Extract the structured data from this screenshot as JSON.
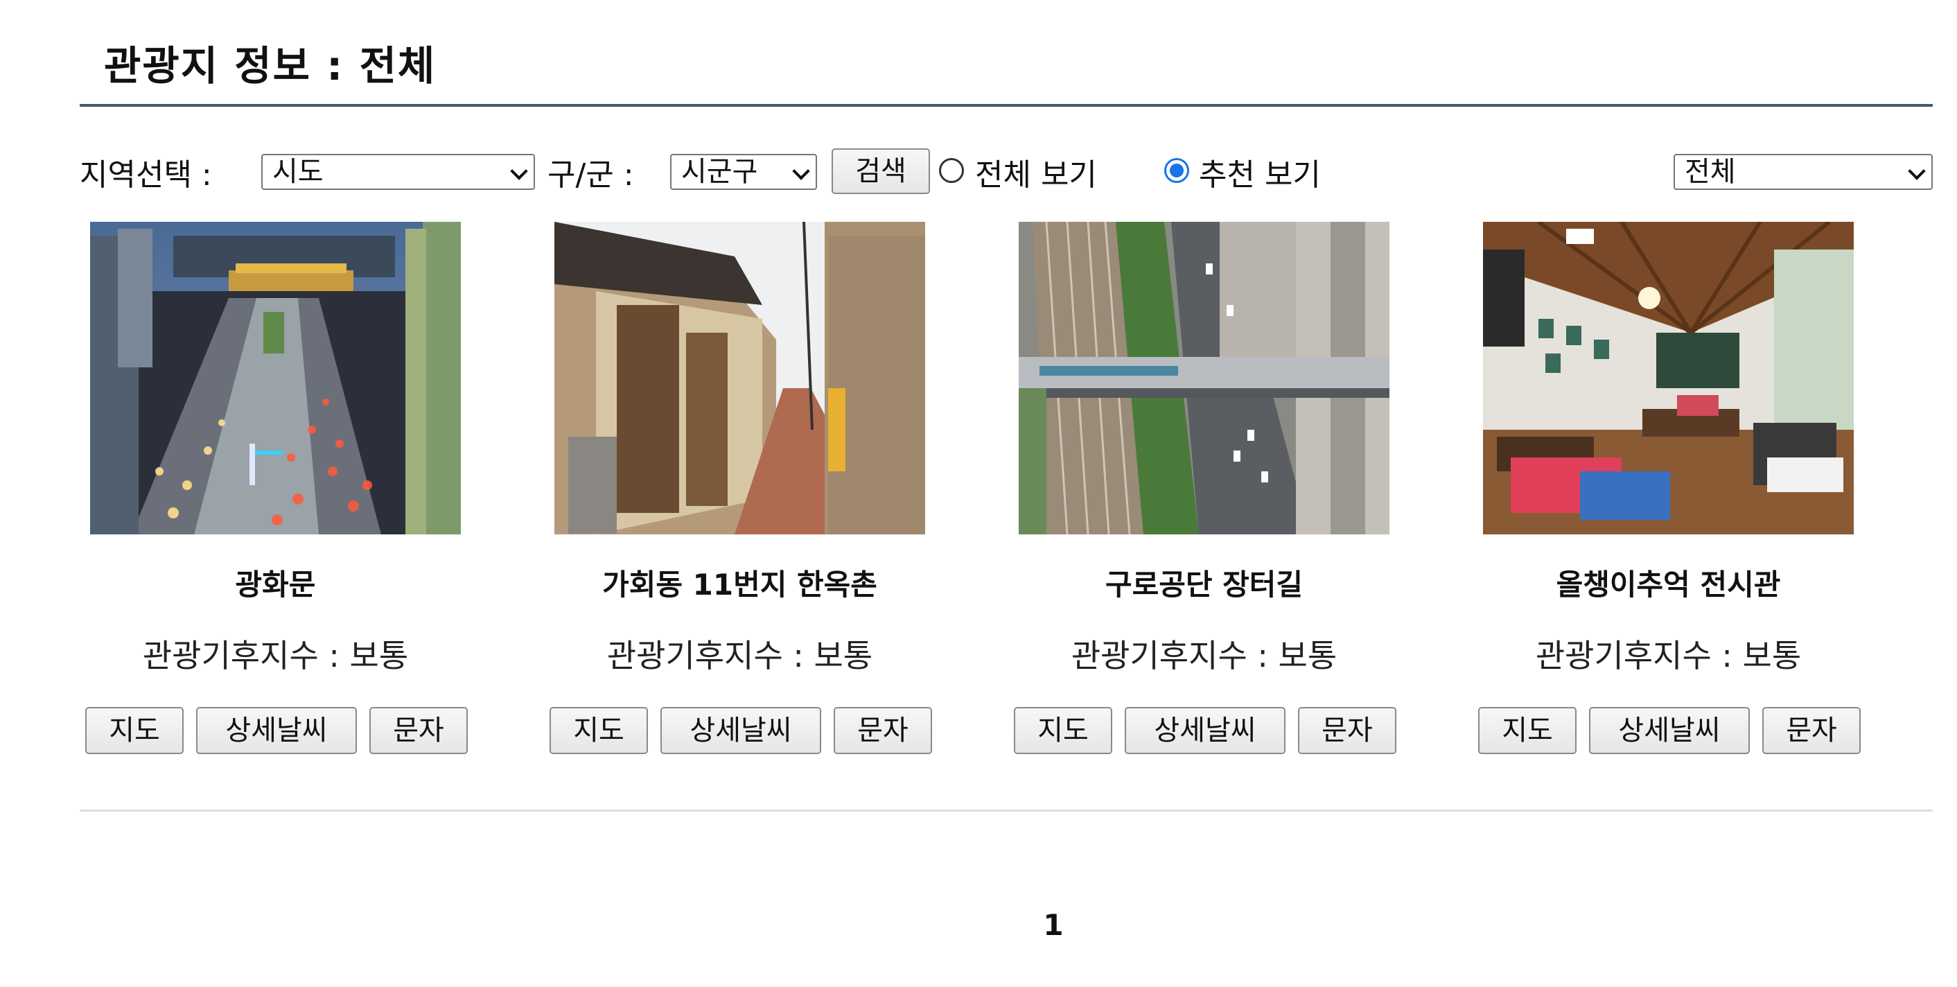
{
  "page": {
    "title": "관광지 정보 : 전체"
  },
  "filters": {
    "region_label": "지역선택 :",
    "sido_selected": "시도",
    "gugun_label": "구/군 :",
    "sigungu_selected": "시군구",
    "search_button": "검색",
    "radio_all_label": "전체 보기",
    "radio_all_checked": false,
    "radio_recommend_label": "추천 보기",
    "radio_recommend_checked": true,
    "category_selected": "전체"
  },
  "cards": [
    {
      "name": "광화문",
      "climate": "관광기후지수 : 보통",
      "btn_map": "지도",
      "btn_weather": "상세날씨",
      "btn_sms": "문자"
    },
    {
      "name": "가회동 11번지 한옥촌",
      "climate": "관광기후지수 : 보통",
      "btn_map": "지도",
      "btn_weather": "상세날씨",
      "btn_sms": "문자"
    },
    {
      "name": "구로공단 장터길",
      "climate": "관광기후지수 : 보통",
      "btn_map": "지도",
      "btn_weather": "상세날씨",
      "btn_sms": "문자"
    },
    {
      "name": "올챙이추억 전시관",
      "climate": "관광기후지수 : 보통",
      "btn_map": "지도",
      "btn_weather": "상세날씨",
      "btn_sms": "문자"
    }
  ],
  "pagination": {
    "current_page": "1"
  },
  "colors": {
    "title_rule": "#3f5a6e",
    "radio_accent": "#1a73e8"
  }
}
